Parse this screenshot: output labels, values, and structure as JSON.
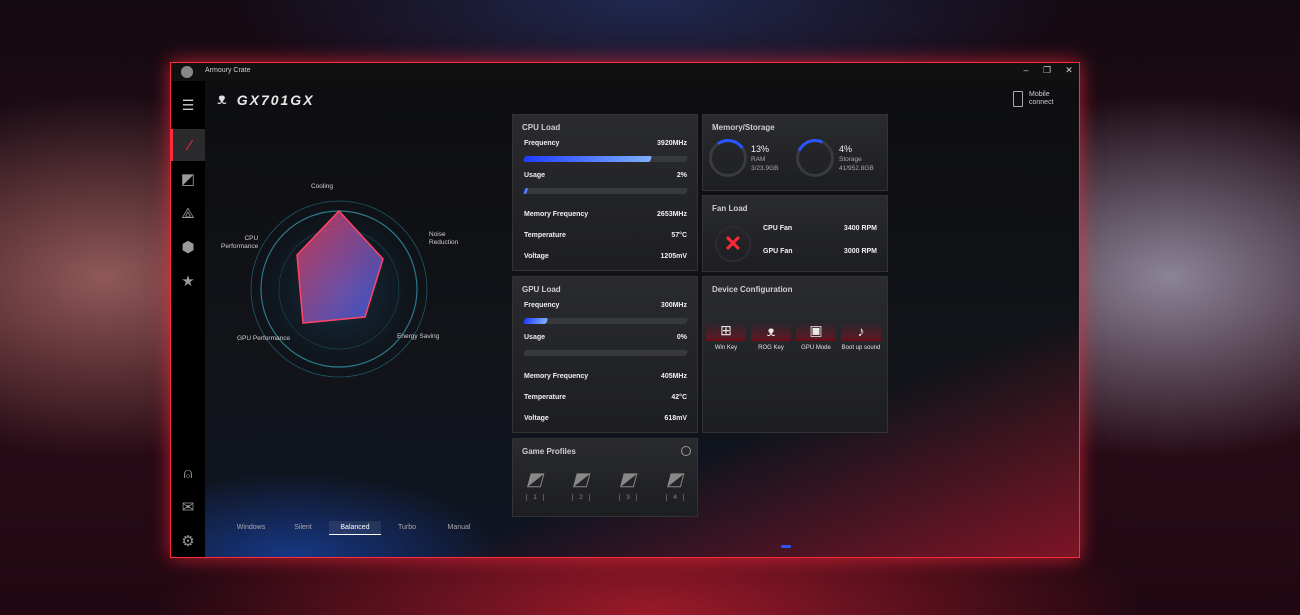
{
  "window": {
    "title": "Armoury Crate",
    "controls": {
      "minimize": "–",
      "restore": "❐",
      "close": "✕"
    }
  },
  "header": {
    "model": "GX701GX",
    "mobile_connect": "Mobile connect"
  },
  "sidebar": {
    "items": [
      {
        "name": "home",
        "icon": "rog-home-icon",
        "glyph": "⁄"
      },
      {
        "name": "game-profile",
        "icon": "profile-icon",
        "glyph": "◩"
      },
      {
        "name": "aura",
        "icon": "aura-triangle-icon",
        "glyph": "⟁"
      },
      {
        "name": "device",
        "icon": "cube-icon",
        "glyph": "⬢"
      },
      {
        "name": "featured",
        "icon": "star-icon",
        "glyph": "★"
      }
    ],
    "bottom": [
      {
        "name": "user",
        "icon": "user-icon",
        "glyph": "⍝"
      },
      {
        "name": "news",
        "icon": "mail-icon",
        "glyph": "✉"
      },
      {
        "name": "settings",
        "icon": "gear-icon",
        "glyph": "⚙"
      }
    ]
  },
  "radar": {
    "labels": {
      "cooling": "Cooling",
      "noise": "Noise\nReduction",
      "energy": "Energy Saving",
      "gpu": "GPU Performance",
      "cpu": "CPU\nPerformance"
    }
  },
  "modes": [
    "Windows",
    "Silent",
    "Balanced",
    "Turbo",
    "Manual"
  ],
  "active_mode": "Balanced",
  "cpu": {
    "title": "CPU Load",
    "frequency_label": "Frequency",
    "frequency": "3920MHz",
    "frequency_bar": 0.78,
    "usage_label": "Usage",
    "usage": "2%",
    "usage_bar": 0.02,
    "mem_label": "Memory Frequency",
    "mem": "2653MHz",
    "temp_label": "Temperature",
    "temp": "57°C",
    "volt_label": "Voltage",
    "volt": "1205mV"
  },
  "gpu": {
    "title": "GPU Load",
    "frequency_label": "Frequency",
    "frequency": "300MHz",
    "frequency_bar": 0.14,
    "usage_label": "Usage",
    "usage": "0%",
    "usage_bar": 0.0,
    "mem_label": "Memory Frequency",
    "mem": "405MHz",
    "temp_label": "Temperature",
    "temp": "42°C",
    "volt_label": "Voltage",
    "volt": "618mV"
  },
  "memory": {
    "title": "Memory/Storage",
    "ram_pct": "13%",
    "ram_label": "RAM",
    "ram_detail": "3/23.9GB",
    "storage_pct": "4%",
    "storage_label": "Storage",
    "storage_detail": "41/952.8GB"
  },
  "fan": {
    "title": "Fan Load",
    "cpu_label": "CPU Fan",
    "cpu_rpm": "3400 RPM",
    "gpu_label": "GPU Fan",
    "gpu_rpm": "3000 RPM"
  },
  "device": {
    "title": "Device Configuration",
    "items": [
      {
        "label": "Win Key",
        "icon": "windows-icon",
        "glyph": "⊞"
      },
      {
        "label": "ROG Key",
        "icon": "rog-icon",
        "glyph": "ᴥ"
      },
      {
        "label": "GPU Mode",
        "icon": "gpu-icon",
        "glyph": "▣"
      },
      {
        "label": "Boot up sound",
        "icon": "sound-icon",
        "glyph": "♪"
      }
    ]
  },
  "game_profiles": {
    "title": "Game Profiles",
    "items": [
      "[ 1 ]",
      "[ 2 ]",
      "[ 3 ]",
      "[ 4 ]"
    ]
  },
  "colors": {
    "accent": "#ff2a3a",
    "bar": "#2a55ff"
  }
}
